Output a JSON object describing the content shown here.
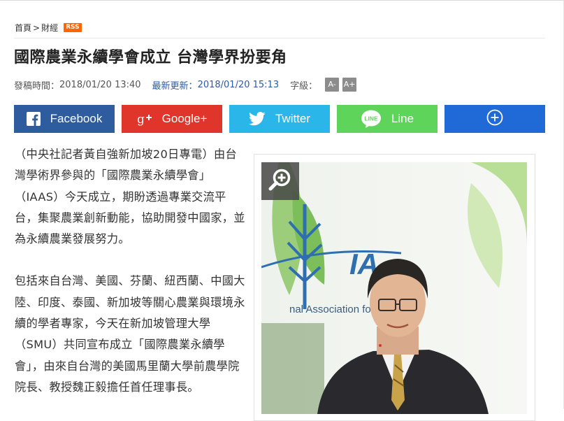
{
  "breadcrumb": {
    "home": "首頁",
    "separator": ">",
    "section": "財經",
    "rss_label": "RSS"
  },
  "article": {
    "title": "國際農業永續學會成立 台灣學界扮要角",
    "published_label": "發稿時間：",
    "published_value": "2018/01/20 13:40",
    "updated_label": "最新更新：",
    "updated_value": "2018/01/20 15:13",
    "font_size_label": "字級：",
    "font_decrease": "A-",
    "font_increase": "A+",
    "paragraphs": [
      "（中央社記者黃自強新加坡20日專電）由台灣學術界參與的「國際農業永續學會」（IAAS）今天成立，期盼透過專業交流平台，集聚農業創新動能，協助開發中國家，並為永續農業發展努力。",
      "包括來自台灣、美國、芬蘭、紐西蘭、中國大陸、印度、泰國、新加坡等關心農業與環境永續的學者專家，今天在新加坡管理大學（SMU）共同宣布成立「國際農業永續學會」，由來自台灣的美國馬里蘭大學前農學院院長、教授魏正毅擔任首任理事長。"
    ]
  },
  "share": {
    "facebook": "Facebook",
    "google": "Google+",
    "twitter": "Twitter",
    "line": "Line",
    "line_icon_text": "LINE"
  },
  "photo": {
    "banner_text": "nal Association for A"
  },
  "colors": {
    "facebook": "#2f5c9e",
    "google": "#e0352b",
    "twitter": "#2bb6e9",
    "line": "#5fd45b",
    "more": "#1f6ad6",
    "rss": "#ff6600",
    "link": "#2b5aa6"
  },
  "icons": [
    "facebook-icon",
    "google-plus-icon",
    "twitter-icon",
    "line-icon",
    "plus-circle-icon",
    "zoom-in-icon"
  ]
}
